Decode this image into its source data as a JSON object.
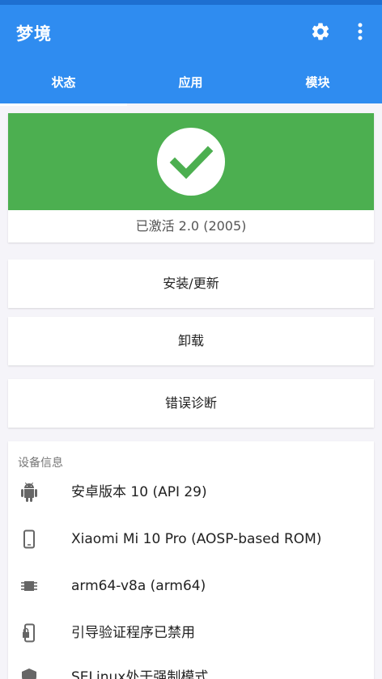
{
  "app": {
    "title": "梦境",
    "tabs": [
      {
        "label": "状态",
        "selected": true
      },
      {
        "label": "应用",
        "selected": false
      },
      {
        "label": "模块",
        "selected": false
      }
    ]
  },
  "status": {
    "text": "已激活 2.0 (2005)",
    "icon": "check-circle-icon",
    "color": "#4caf50"
  },
  "buttons": {
    "install": "安装/更新",
    "uninstall": "卸载",
    "diagnose": "错误诊断"
  },
  "device_info": {
    "header": "设备信息",
    "items": [
      {
        "icon": "android-icon",
        "text": "安卓版本 10 (API 29)"
      },
      {
        "icon": "phone-icon",
        "text": "Xiaomi Mi 10 Pro (AOSP-based ROM)"
      },
      {
        "icon": "chip-icon",
        "text": "arm64-v8a (arm64)"
      },
      {
        "icon": "phone-lock-icon",
        "text": "引导验证程序已禁用"
      },
      {
        "icon": "shield-icon",
        "text": "SELinux处于强制模式"
      }
    ]
  },
  "colors": {
    "primary": "#2f8cf0",
    "active_green": "#4caf50"
  }
}
